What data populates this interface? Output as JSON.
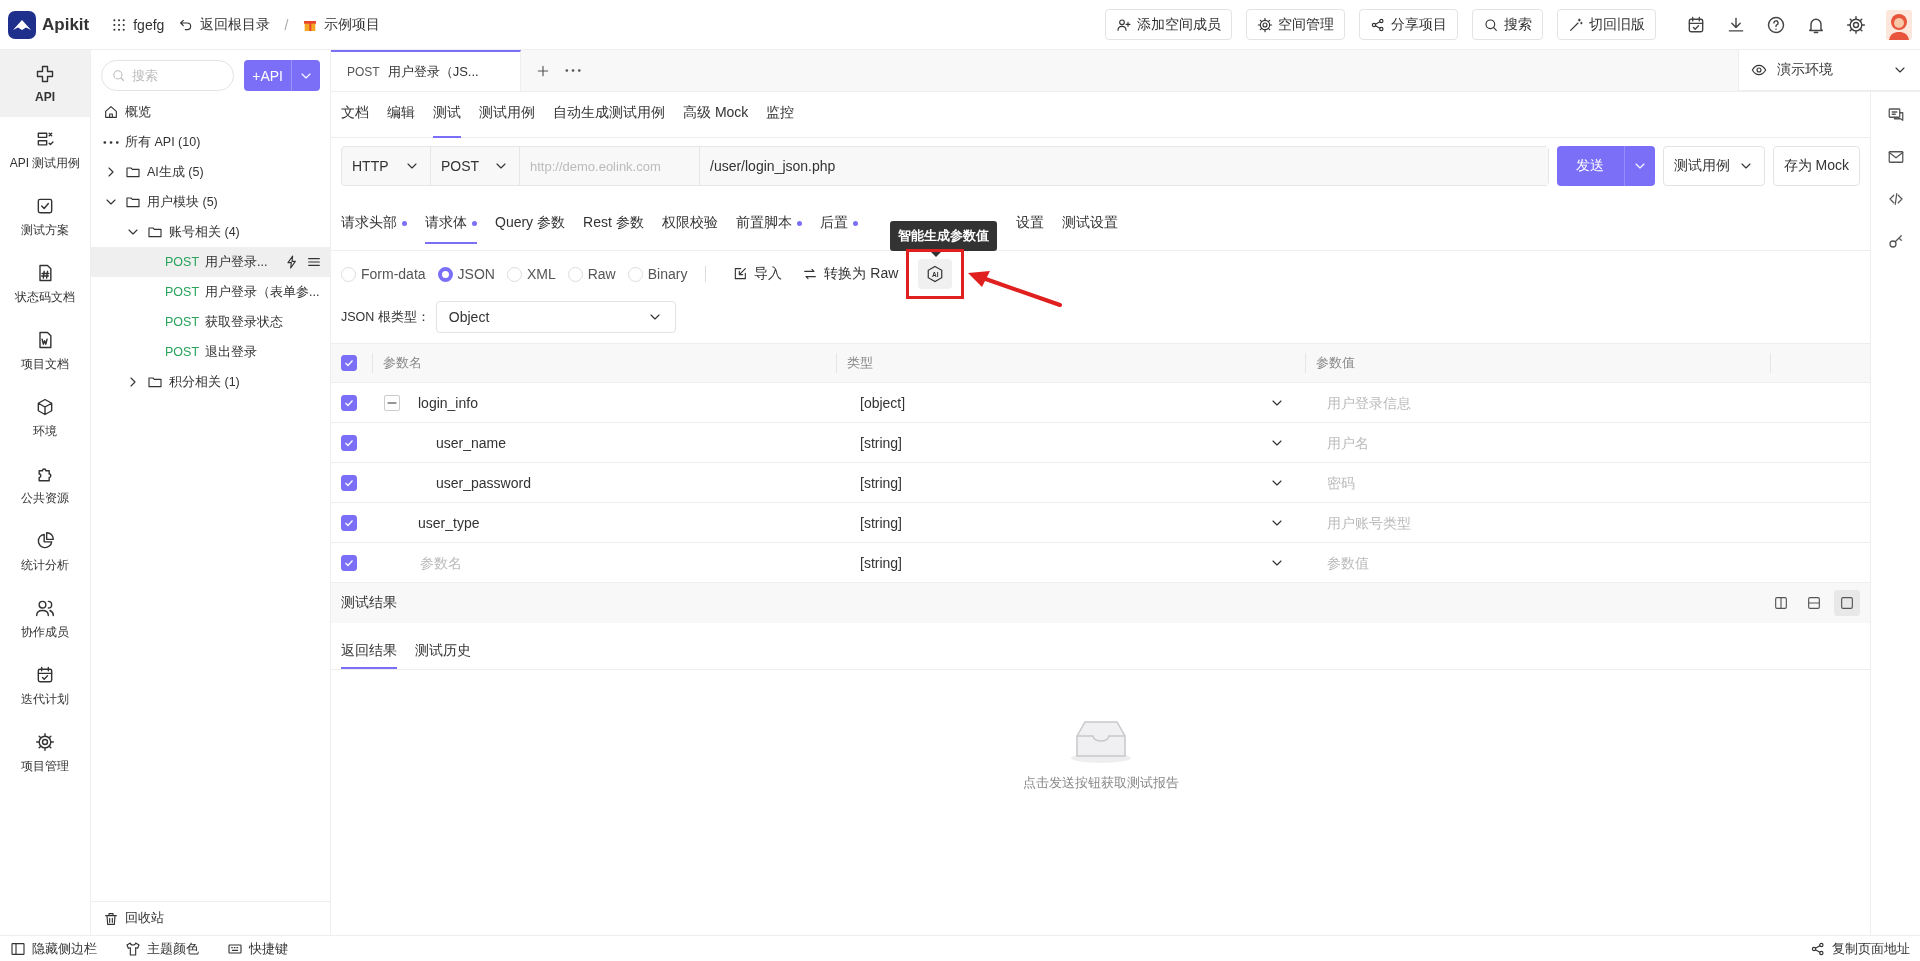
{
  "topbar": {
    "logo": "Apikit",
    "workspace": "fgefg",
    "back": "返回根目录",
    "separator": "/",
    "project": "示例项目",
    "buttons": [
      {
        "kind": "add-user",
        "label": "添加空间成员"
      },
      {
        "kind": "gear",
        "label": "空间管理"
      },
      {
        "kind": "share",
        "label": "分享项目"
      },
      {
        "kind": "search",
        "label": "搜索"
      },
      {
        "kind": "wand",
        "label": "切回旧版"
      }
    ]
  },
  "rail": {
    "items": [
      {
        "kind": "api",
        "label": "API",
        "selected": true
      },
      {
        "kind": "cases",
        "label": "API 测试用例",
        "selected": false
      },
      {
        "kind": "plan",
        "label": "测试方案",
        "selected": false
      },
      {
        "kind": "status",
        "label": "状态码文档",
        "selected": false
      },
      {
        "kind": "doc",
        "label": "项目文档",
        "selected": false
      },
      {
        "kind": "env",
        "label": "环境",
        "selected": false
      },
      {
        "kind": "resource",
        "label": "公共资源",
        "selected": false
      },
      {
        "kind": "stats",
        "label": "统计分析",
        "selected": false
      },
      {
        "kind": "members",
        "label": "协作成员",
        "selected": false
      },
      {
        "kind": "iteration",
        "label": "迭代计划",
        "selected": false
      },
      {
        "kind": "settings",
        "label": "项目管理",
        "selected": false
      }
    ]
  },
  "tree": {
    "search": {
      "placeholder": "搜索"
    },
    "add_button": "+API",
    "items": [
      {
        "kind": "home",
        "label": "概览"
      },
      {
        "kind": "all",
        "label": "所有 API (10)"
      },
      {
        "kind": "folder",
        "label": "AI生成 (5)",
        "expanded": false
      },
      {
        "kind": "folder",
        "label": "用户模块 (5)",
        "expanded": true,
        "children": [
          {
            "kind": "folder",
            "label": "账号相关 (4)",
            "expanded": true,
            "children": [
              {
                "kind": "api",
                "method": "POST",
                "label": "用户登录...",
                "selected": true
              },
              {
                "kind": "api",
                "method": "POST",
                "label": "用户登录（表单参...",
                "selected": false
              },
              {
                "kind": "api",
                "method": "POST",
                "label": "获取登录状态",
                "selected": false
              },
              {
                "kind": "api",
                "method": "POST",
                "label": "退出登录",
                "selected": false
              }
            ]
          },
          {
            "kind": "folder",
            "label": "积分相关 (1)",
            "expanded": false
          }
        ]
      }
    ],
    "trash": "回收站"
  },
  "editor_tabs": [
    {
      "method": "POST",
      "title": "用户登录（JS...",
      "selected": true
    }
  ],
  "environment": "演示环境",
  "sub_tabs": [
    {
      "label": "文档",
      "selected": false
    },
    {
      "label": "编辑",
      "selected": false
    },
    {
      "label": "测试",
      "selected": true
    },
    {
      "label": "测试用例",
      "selected": false
    },
    {
      "label": "自动生成测试用例",
      "selected": false
    },
    {
      "label": "高级 Mock",
      "selected": false
    },
    {
      "label": "监控",
      "selected": false
    }
  ],
  "request": {
    "protocol": "HTTP",
    "method": "POST",
    "host": {
      "placeholder": "http://demo.eolink.com"
    },
    "path": "/user/login_json.php",
    "send": "发送",
    "test_case": "测试用例",
    "save_mock": "存为 Mock"
  },
  "request_tabs": [
    {
      "label": "请求头部",
      "dot": true,
      "selected": false
    },
    {
      "label": "请求体",
      "dot": true,
      "selected": true
    },
    {
      "label": "Query 参数",
      "dot": false,
      "selected": false
    },
    {
      "label": "Rest 参数",
      "dot": false,
      "selected": false
    },
    {
      "label": "权限校验",
      "dot": false,
      "selected": false
    },
    {
      "label": "前置脚本",
      "dot": true,
      "selected": false
    },
    {
      "label": "后置",
      "dot": true,
      "selected": false
    },
    {
      "label": "设置",
      "dot": false,
      "selected": false
    },
    {
      "label": "测试设置",
      "dot": false,
      "selected": false
    }
  ],
  "body_types": [
    {
      "label": "Form-data",
      "selected": false
    },
    {
      "label": "JSON",
      "selected": true
    },
    {
      "label": "XML",
      "selected": false
    },
    {
      "label": "Raw",
      "selected": false
    },
    {
      "label": "Binary",
      "selected": false
    }
  ],
  "body_actions": {
    "import": "导入",
    "convert": "转换为 Raw",
    "ai": "AI",
    "ai_tooltip": "智能生成参数值"
  },
  "annotation": {
    "frame": true,
    "arrow": true
  },
  "root_type": {
    "label": "JSON 根类型：",
    "value": "Object"
  },
  "params": {
    "all_checked": true,
    "columns": [
      "参数名",
      "类型",
      "参数值"
    ],
    "rows": [
      {
        "checked": true,
        "name": "login_info",
        "type": "[object]",
        "value_placeholder": "用户登录信息",
        "expanded": true,
        "children": [
          {
            "checked": true,
            "name": "user_name",
            "type": "[string]",
            "value_placeholder": "用户名"
          },
          {
            "checked": true,
            "name": "user_password",
            "type": "[string]",
            "value_placeholder": "密码"
          }
        ]
      },
      {
        "checked": true,
        "name": "user_type",
        "type": "[string]",
        "value_placeholder": "用户账号类型"
      },
      {
        "checked": true,
        "name_placeholder": "参数名",
        "type": "[string]",
        "value_placeholder": "参数值"
      }
    ]
  },
  "results": {
    "title": "测试结果",
    "layouts": [
      {
        "kind": "columns",
        "selected": false
      },
      {
        "kind": "rows",
        "selected": false
      },
      {
        "kind": "single",
        "selected": true
      }
    ],
    "tabs": [
      {
        "label": "返回结果",
        "selected": true
      },
      {
        "label": "测试历史",
        "selected": false
      }
    ],
    "empty": "点击发送按钮获取测试报告"
  },
  "bottom_bar": {
    "items": [
      {
        "kind": "sidebar",
        "label": "隐藏侧边栏"
      },
      {
        "kind": "shirt",
        "label": "主题颜色"
      },
      {
        "kind": "keyboard",
        "label": "快捷键"
      }
    ],
    "copy_link": "复制页面地址"
  }
}
